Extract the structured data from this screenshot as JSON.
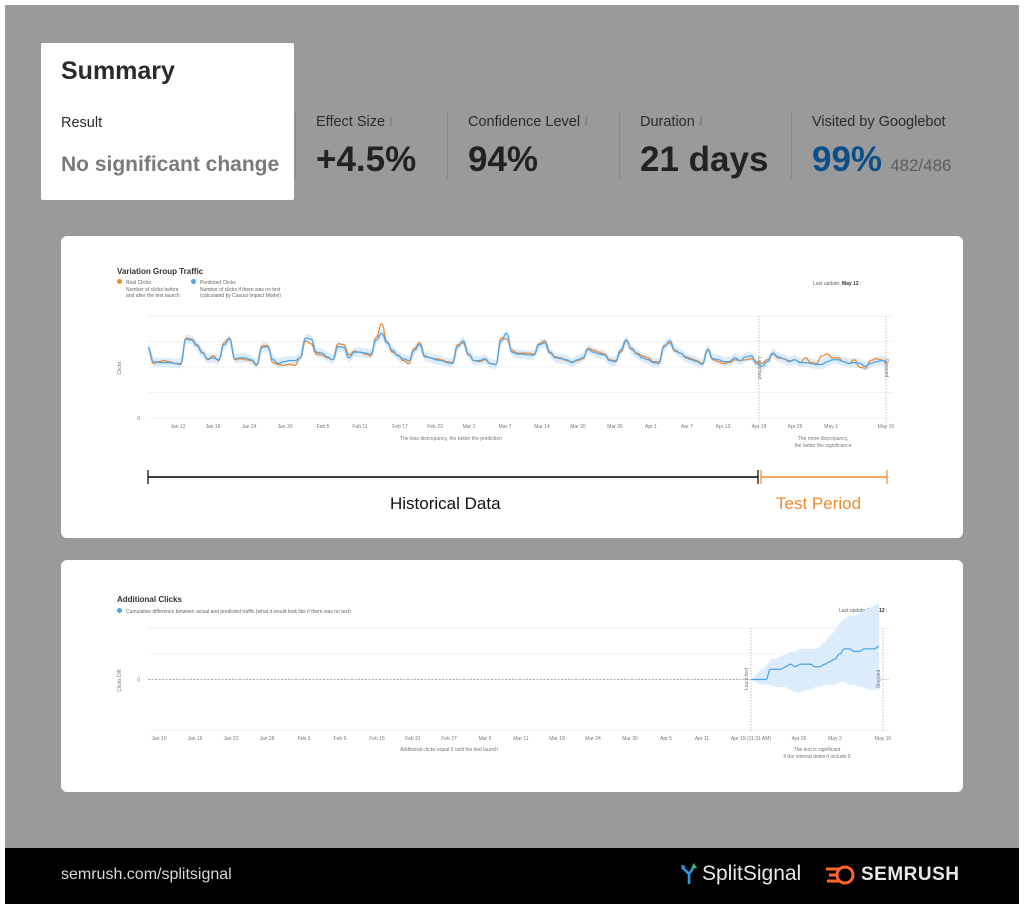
{
  "summary": {
    "title": "Summary",
    "result_label": "Result",
    "result_value": "No significant change"
  },
  "metrics": [
    {
      "label": "Effect Size",
      "value": "+4.5%",
      "has_info": true
    },
    {
      "label": "Confidence Level",
      "value": "94%",
      "has_info": true
    },
    {
      "label": "Duration",
      "value": "21 days",
      "has_info": true
    },
    {
      "label": "Visited by Googlebot",
      "value": "99%",
      "sub": "482/486",
      "has_info": false,
      "value_color": "#0b4f8a"
    }
  ],
  "info_glyph": "i",
  "colors": {
    "real": "#f08a2e",
    "predicted": "#4ea6ea",
    "band": "#dcecfb",
    "test_period": "#f08a2e"
  },
  "chart_data": [
    {
      "type": "line",
      "title": "Variation Group Traffic",
      "legend": [
        {
          "name": "Real Clicks",
          "desc1": "Number of clicks before",
          "desc2": "and after the test launch",
          "color": "#f08a2e"
        },
        {
          "name": "Predicted Clicks",
          "desc1": "Number of clicks if there was no test",
          "desc2": "(calculated by Casual Impact Model)",
          "color": "#4ea6ea"
        }
      ],
      "last_update_label": "Last update:",
      "last_update_value": "May 12",
      "ylabel": "Clicks",
      "y_tick_labels": [
        "0"
      ],
      "ylim": [
        0,
        100
      ],
      "x_tick_labels": [
        "Jan 12",
        "Jan 18",
        "Jan 24",
        "Jan 30",
        "Feb 5",
        "Feb 11",
        "Feb 17",
        "Feb 23",
        "Mar 1",
        "Mar 7",
        "Mar 14",
        "Mar 20",
        "Mar 26",
        "Apr 1",
        "Apr 7",
        "Apr 13",
        "Apr 19",
        "Apr 25",
        "May 1",
        "May 10"
      ],
      "markers": [
        {
          "label": "Launched",
          "at": "Apr 19"
        },
        {
          "label": "Stopped",
          "at": "May 10"
        }
      ],
      "note_left": "The less discrepancy, the better the prediction",
      "note_right_1": "The more discrepancy,",
      "note_right_2": "the better the significance",
      "series": [
        {
          "name": "Real Clicks",
          "values": [
            75,
            58,
            60,
            61,
            60,
            58,
            57,
            85,
            84,
            78,
            70,
            62,
            66,
            61,
            80,
            85,
            62,
            63,
            62,
            61,
            56,
            77,
            77,
            59,
            57,
            56,
            57,
            56,
            64,
            82,
            79,
            68,
            67,
            64,
            62,
            79,
            78,
            67,
            71,
            70,
            68,
            66,
            86,
            100,
            81,
            70,
            67,
            61,
            58,
            74,
            80,
            66,
            64,
            63,
            62,
            60,
            59,
            78,
            80,
            67,
            61,
            60,
            62,
            58,
            57,
            85,
            84,
            72,
            69,
            69,
            69,
            68,
            79,
            82,
            70,
            65,
            64,
            61,
            60,
            61,
            63,
            74,
            72,
            70,
            68,
            62,
            61,
            70,
            82,
            74,
            69,
            66,
            64,
            60,
            60,
            77,
            80,
            71,
            69,
            65,
            63,
            61,
            58,
            72,
            62,
            60,
            58,
            59,
            62,
            61,
            62,
            63,
            60,
            58,
            62,
            68,
            64,
            63,
            61,
            62,
            59,
            64,
            59,
            58,
            66,
            68,
            64,
            64,
            60,
            58,
            62,
            54,
            53,
            61,
            63,
            62,
            58
          ]
        },
        {
          "name": "Predicted Clicks",
          "values": [
            75,
            60,
            59,
            59,
            59,
            58,
            58,
            84,
            83,
            77,
            69,
            63,
            64,
            62,
            78,
            84,
            63,
            64,
            64,
            62,
            57,
            75,
            76,
            62,
            58,
            60,
            61,
            61,
            64,
            85,
            84,
            70,
            69,
            65,
            62,
            76,
            75,
            64,
            70,
            70,
            69,
            68,
            83,
            90,
            80,
            72,
            66,
            63,
            61,
            72,
            78,
            65,
            64,
            62,
            61,
            59,
            58,
            76,
            82,
            68,
            61,
            61,
            63,
            58,
            57,
            82,
            90,
            70,
            68,
            68,
            67,
            67,
            78,
            80,
            69,
            64,
            63,
            62,
            59,
            62,
            64,
            73,
            70,
            68,
            67,
            61,
            60,
            72,
            83,
            73,
            68,
            64,
            62,
            59,
            58,
            76,
            82,
            72,
            69,
            64,
            62,
            60,
            57,
            73,
            63,
            62,
            60,
            60,
            64,
            61,
            65,
            66,
            58,
            55,
            60,
            69,
            65,
            63,
            60,
            62,
            59,
            59,
            58,
            57,
            57,
            60,
            62,
            62,
            60,
            58,
            59,
            58,
            55,
            58,
            60,
            61,
            60
          ]
        }
      ]
    },
    {
      "type": "area",
      "title": "Additional Clicks",
      "legend": [
        {
          "name": "Cumulative difference between actual and predicted traffic (what it would look like if there was no test)",
          "color": "#4ea6ea"
        }
      ],
      "last_update_label": "Last update:",
      "last_update_value": "May 12",
      "ylabel": "Clicks Diff.",
      "y_tick_labels": [
        "0"
      ],
      "ylim": [
        -10,
        30
      ],
      "x_tick_labels": [
        "Jan 10",
        "Jan 16",
        "Jan 22",
        "Jan 28",
        "Feb 3",
        "Feb 9",
        "Feb 15",
        "Feb 21",
        "Feb 27",
        "Mar 5",
        "Mar 11",
        "Mar 18",
        "Mar 24",
        "Mar 30",
        "Apr 5",
        "Apr 11",
        "Apr 19 (11:31 AM)",
        "Apr 26",
        "May 2",
        "May 10"
      ],
      "markers": [
        {
          "label": "Launched",
          "at": "Apr 19"
        },
        {
          "label": "Stopped",
          "at": "May 10"
        }
      ],
      "note_left": "Additional clicks equal 0 until the test launch",
      "note_right_1": "The test is significant",
      "note_right_2": "if the interval doesn't include 0",
      "series": [
        {
          "name": "Cumulative difference",
          "values": [
            0,
            0,
            0,
            0,
            4,
            4,
            4,
            5,
            6,
            5,
            6,
            6,
            6,
            5,
            5,
            6,
            7,
            8,
            10,
            12,
            12,
            11,
            11,
            12,
            12,
            12,
            13
          ],
          "lower": [
            0,
            -1,
            -2,
            -2,
            -2,
            -3,
            -3,
            -3,
            -4,
            -5,
            -5,
            -4,
            -4,
            -3,
            -3,
            -2,
            -2,
            -2,
            -1,
            -1,
            -2,
            -2,
            -3,
            -3,
            -4,
            -4,
            -4
          ],
          "upper": [
            0,
            2,
            4,
            5,
            8,
            8,
            9,
            10,
            11,
            11,
            12,
            12,
            12,
            12,
            13,
            15,
            17,
            19,
            22,
            24,
            25,
            25,
            26,
            27,
            28,
            29,
            30
          ]
        }
      ]
    }
  ],
  "periods": {
    "historical": "Historical Data",
    "test": "Test Period"
  },
  "footer": {
    "url": "semrush.com/splitsignal",
    "brand1": "SplitSignal",
    "brand2": "SEMRUSH"
  }
}
